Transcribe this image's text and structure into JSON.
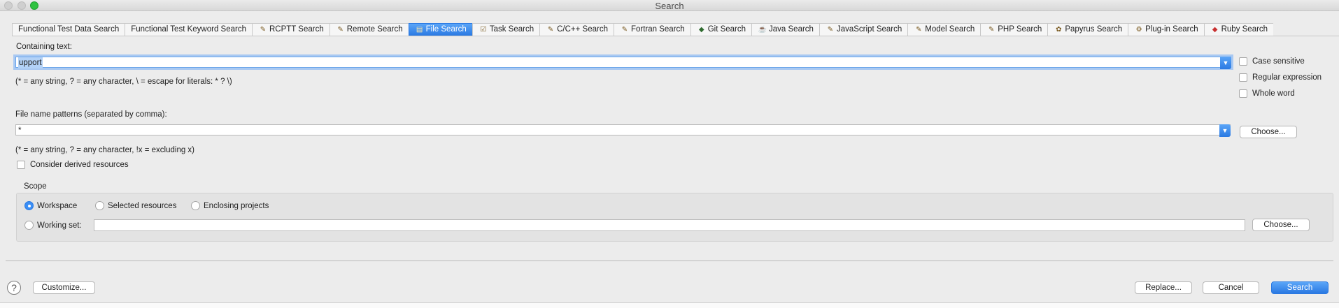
{
  "window": {
    "title": "Search"
  },
  "tabs": [
    {
      "label": "Functional Test Data Search",
      "icon": ""
    },
    {
      "label": "Functional Test Keyword Search",
      "icon": ""
    },
    {
      "label": "RCPTT Search",
      "icon": "flashlight-icon"
    },
    {
      "label": "Remote Search",
      "icon": "flashlight-icon"
    },
    {
      "label": "File Search",
      "icon": "file-search-icon",
      "active": true
    },
    {
      "label": "Task Search",
      "icon": "task-icon"
    },
    {
      "label": "C/C++ Search",
      "icon": "flashlight-icon"
    },
    {
      "label": "Fortran Search",
      "icon": "flashlight-icon"
    },
    {
      "label": "Git Search",
      "icon": "git-icon"
    },
    {
      "label": "Java Search",
      "icon": "java-icon"
    },
    {
      "label": "JavaScript Search",
      "icon": "flashlight-icon"
    },
    {
      "label": "Model Search",
      "icon": "flashlight-icon"
    },
    {
      "label": "PHP Search",
      "icon": "flashlight-icon"
    },
    {
      "label": "Papyrus Search",
      "icon": "papyrus-icon"
    },
    {
      "label": "Plug-in Search",
      "icon": "plugin-icon"
    },
    {
      "label": "Ruby Search",
      "icon": "ruby-icon"
    }
  ],
  "containing": {
    "label": "Containing text:",
    "value": "upport",
    "hint": "(* = any string, ? = any character, \\ = escape for literals: * ? \\)"
  },
  "options": {
    "case_sensitive": "Case sensitive",
    "regex": "Regular expression",
    "whole_word": "Whole word"
  },
  "patterns": {
    "label": "File name patterns (separated by comma):",
    "value": "*",
    "hint": "(* = any string, ? = any character, !x = excluding x)",
    "choose": "Choose..."
  },
  "derived": {
    "label": "Consider derived resources"
  },
  "scope": {
    "label": "Scope",
    "workspace": "Workspace",
    "selected": "Selected resources",
    "enclosing": "Enclosing projects",
    "working_set": "Working set:",
    "choose": "Choose..."
  },
  "footer": {
    "customize": "Customize...",
    "replace": "Replace...",
    "cancel": "Cancel",
    "search": "Search",
    "help": "?"
  },
  "colors": {
    "accent": "#2a79e2",
    "focus_ring": "#a9c9f2"
  }
}
